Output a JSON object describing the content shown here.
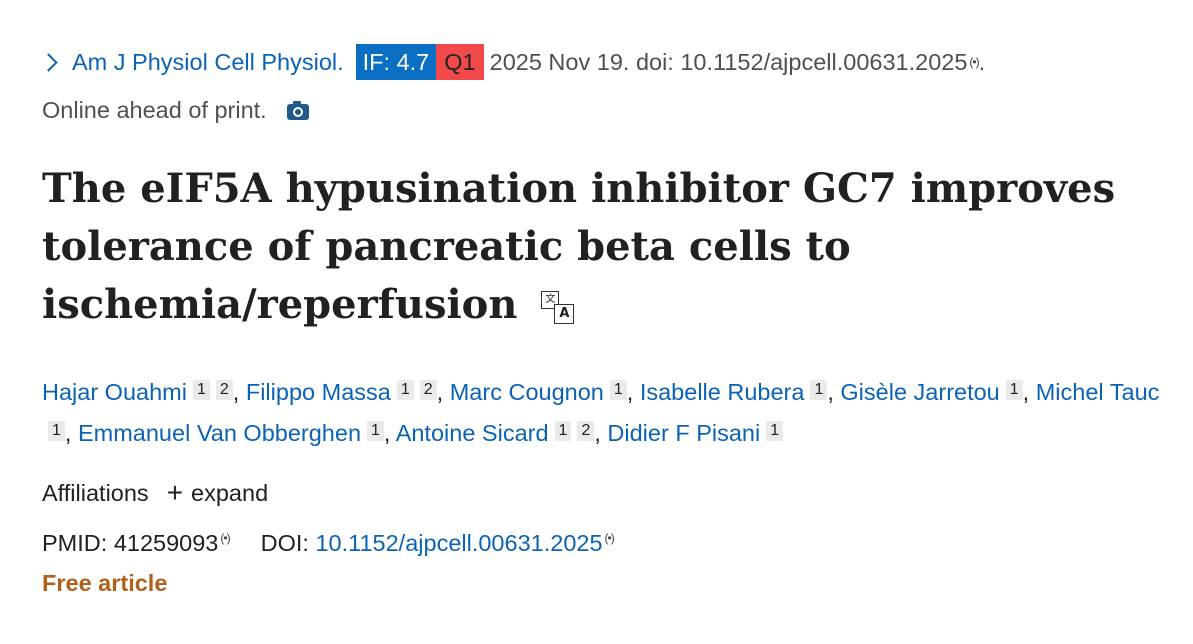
{
  "citation": {
    "journal": "Am J Physiol Cell Physiol.",
    "if_badge": "IF: 4.7",
    "quartile_badge": "Q1",
    "date_doi": "2025 Nov 19. doi: 10.1152/ajpcell.00631.2025",
    "doi_icon": "(•)",
    "end_period": ".",
    "status": "Online ahead of print."
  },
  "title": "The eIF5A hypusination inhibitor GC7 improves tolerance of pancreatic beta cells to ischemia/reperfusion",
  "translate_icon_glyphs": {
    "a": "文",
    "b": "A"
  },
  "authors": [
    {
      "name": "Hajar Ouahmi",
      "affs": [
        "1",
        "2"
      ]
    },
    {
      "name": "Filippo Massa",
      "affs": [
        "1",
        "2"
      ]
    },
    {
      "name": "Marc Cougnon",
      "affs": [
        "1"
      ]
    },
    {
      "name": "Isabelle Rubera",
      "affs": [
        "1"
      ]
    },
    {
      "name": "Gisèle Jarretou",
      "affs": [
        "1"
      ]
    },
    {
      "name": "Michel Tauc",
      "affs": [
        "1"
      ]
    },
    {
      "name": "Emmanuel Van Obberghen",
      "affs": [
        "1"
      ]
    },
    {
      "name": "Antoine Sicard",
      "affs": [
        "1",
        "2"
      ]
    },
    {
      "name": "Didier F Pisani",
      "affs": [
        "1"
      ]
    }
  ],
  "affiliations": {
    "label": "Affiliations",
    "plus": "+",
    "expand": "expand"
  },
  "ids": {
    "pmid_label": "PMID:",
    "pmid": "41259093",
    "doi_label": "DOI:",
    "doi": "10.1152/ajpcell.00631.2025",
    "icon": "(•)"
  },
  "free_article": "Free article",
  "colors": {
    "link": "#0b63b5",
    "if_badge": "#0a6fc2",
    "q_badge": "#f24a4a",
    "free": "#b0601a"
  }
}
